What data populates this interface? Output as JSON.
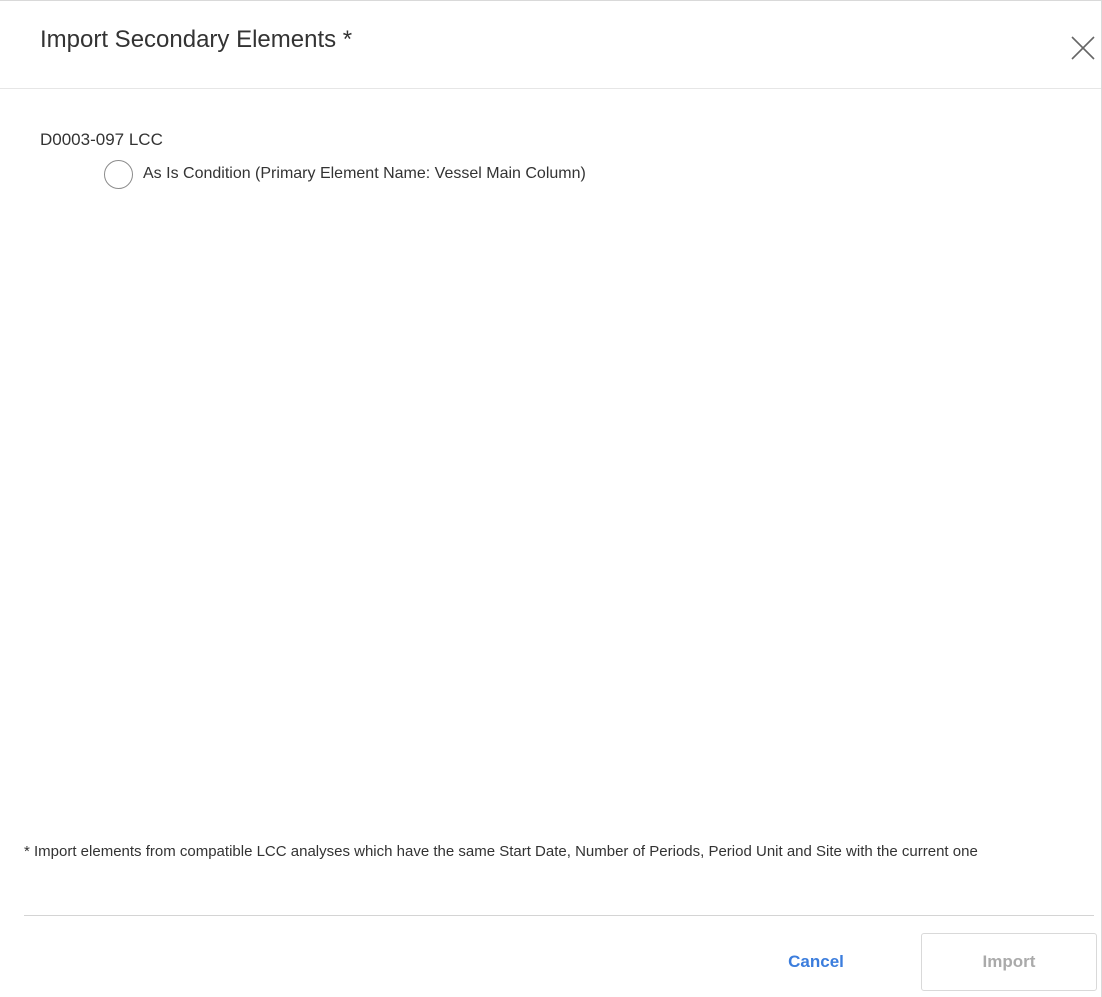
{
  "dialog": {
    "title": "Import Secondary Elements *",
    "close_icon": "close-icon"
  },
  "analysis": {
    "name": "D0003-097 LCC",
    "options": [
      {
        "label": "As Is Condition (Primary Element Name: Vessel Main Column)",
        "selected": false
      }
    ]
  },
  "footnote": "* Import elements from compatible LCC analyses which have the same Start Date, Number of Periods, Period Unit and Site with the current one",
  "buttons": {
    "cancel_label": "Cancel",
    "import_label": "Import",
    "import_enabled": false
  },
  "colors": {
    "link_blue": "#3b7ddd",
    "disabled_text": "#aaaaaa"
  }
}
